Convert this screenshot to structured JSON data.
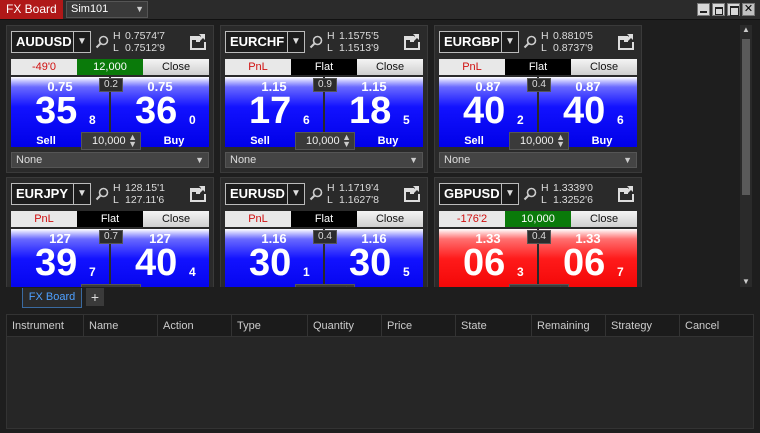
{
  "window": {
    "title": "FX Board",
    "account": "Sim101",
    "close_glyph": "✕"
  },
  "tiles": [
    {
      "symbol": "AUDUSD",
      "high_label": "H",
      "high": "0.7574'7",
      "low_label": "L",
      "low": "0.7512'9",
      "pnl": "-49'0",
      "position": "12,000",
      "position_state": "long",
      "close": "Close",
      "sell_prefix": "0.75",
      "sell_big": "35",
      "sell_pip": "8",
      "buy_prefix": "0.75",
      "buy_big": "36",
      "buy_pip": "0",
      "spread": "0.2",
      "sell_label": "Sell",
      "buy_label": "Buy",
      "quantity": "10,000",
      "strategy": "None",
      "color": "blue"
    },
    {
      "symbol": "EURCHF",
      "high_label": "H",
      "high": "1.1575'5",
      "low_label": "L",
      "low": "1.1513'9",
      "pnl": "PnL",
      "position": "Flat",
      "position_state": "flat",
      "close": "Close",
      "sell_prefix": "1.15",
      "sell_big": "17",
      "sell_pip": "6",
      "buy_prefix": "1.15",
      "buy_big": "18",
      "buy_pip": "5",
      "spread": "0.9",
      "sell_label": "Sell",
      "buy_label": "Buy",
      "quantity": "10,000",
      "strategy": "None",
      "color": "blue"
    },
    {
      "symbol": "EURGBP",
      "high_label": "H",
      "high": "0.8810'5",
      "low_label": "L",
      "low": "0.8737'9",
      "pnl": "PnL",
      "position": "Flat",
      "position_state": "flat",
      "close": "Close",
      "sell_prefix": "0.87",
      "sell_big": "40",
      "sell_pip": "2",
      "buy_prefix": "0.87",
      "buy_big": "40",
      "buy_pip": "6",
      "spread": "0.4",
      "sell_label": "Sell",
      "buy_label": "Buy",
      "quantity": "10,000",
      "strategy": "None",
      "color": "blue"
    },
    {
      "symbol": "EURJPY",
      "high_label": "H",
      "high": "128.15'1",
      "low_label": "L",
      "low": "127.11'6",
      "pnl": "PnL",
      "position": "Flat",
      "position_state": "flat",
      "close": "Close",
      "sell_prefix": "127",
      "sell_big": "39",
      "sell_pip": "7",
      "buy_prefix": "127",
      "buy_big": "40",
      "buy_pip": "4",
      "spread": "0.7",
      "sell_label": "Sell",
      "buy_label": "Buy",
      "quantity": "10,000",
      "strategy": "None",
      "color": "blue"
    },
    {
      "symbol": "EURUSD",
      "high_label": "H",
      "high": "1.1719'4",
      "low_label": "L",
      "low": "1.1627'8",
      "pnl": "PnL",
      "position": "Flat",
      "position_state": "flat",
      "close": "Close",
      "sell_prefix": "1.16",
      "sell_big": "30",
      "sell_pip": "1",
      "buy_prefix": "1.16",
      "buy_big": "30",
      "buy_pip": "5",
      "spread": "0.4",
      "sell_label": "Sell",
      "buy_label": "Buy",
      "quantity": "10,000",
      "strategy": "None",
      "color": "blue"
    },
    {
      "symbol": "GBPUSD",
      "high_label": "H",
      "high": "1.3339'0",
      "low_label": "L",
      "low": "1.3252'6",
      "pnl": "-176'2",
      "position": "10,000",
      "position_state": "long",
      "close": "Close",
      "sell_prefix": "1.33",
      "sell_big": "06",
      "sell_pip": "3",
      "buy_prefix": "1.33",
      "buy_big": "06",
      "buy_pip": "7",
      "spread": "0.4",
      "sell_label": "Sell",
      "buy_label": "Buy",
      "quantity": "10,000",
      "strategy": "None",
      "color": "red"
    }
  ],
  "bottom_tabs": {
    "active": "FX Board",
    "add": "+"
  },
  "orders_grid": {
    "columns": [
      "Instrument",
      "Name",
      "Action",
      "Type",
      "Quantity",
      "Price",
      "State",
      "Remaining",
      "Strategy",
      "Cancel"
    ]
  },
  "colors": {
    "title_red": "#b01818",
    "bid_blue": "#0000e8",
    "ask_red": "#ee0000",
    "long_green": "#0a7a0a"
  }
}
